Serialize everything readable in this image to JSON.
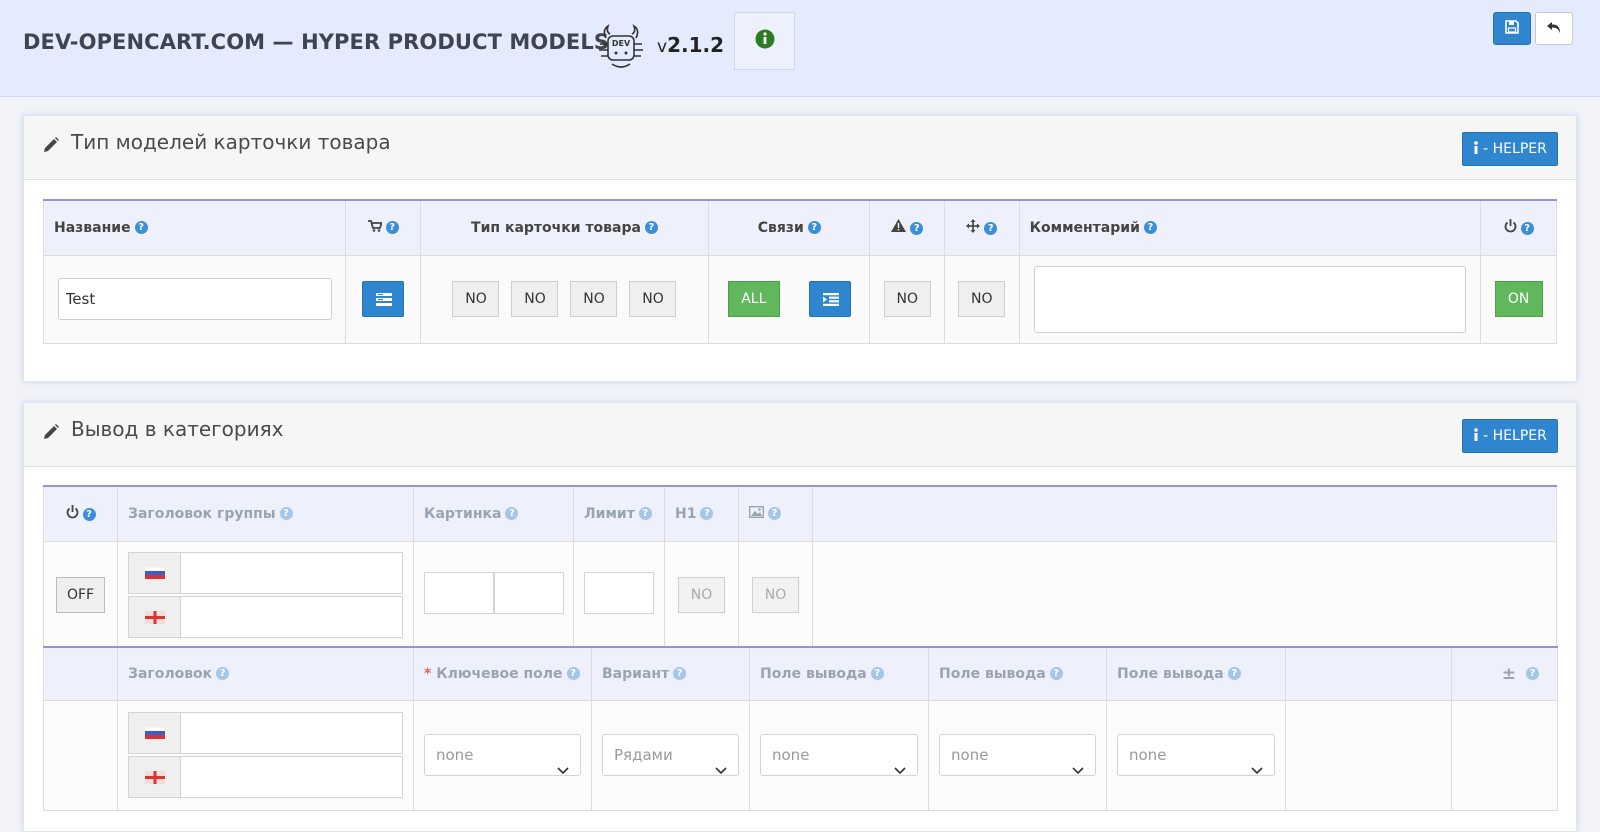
{
  "header": {
    "title": "DEV-OPENCART.COM — HYPER PRODUCT MODELS",
    "logo_text": "DEV",
    "version_prefix": "v",
    "version": "2.1.2"
  },
  "panel1": {
    "title": "Тип моделей карточки товара",
    "helper_label": "- HELPER",
    "columns": {
      "name": "Название",
      "card_type": "Тип карточки товара",
      "links": "Связи",
      "comment": "Комментарий"
    },
    "row": {
      "name_value": "Test",
      "card_type_buttons": [
        "NO",
        "NO",
        "NO",
        "NO"
      ],
      "links_all": "ALL",
      "warning_value": "NO",
      "move_value": "NO",
      "comment_value": "",
      "status": "ON"
    }
  },
  "panel2": {
    "title": "Вывод в категориях",
    "helper_label": "- HELPER",
    "group_columns": {
      "group_title": "Заголовок группы",
      "image": "Картинка",
      "limit": "Лимит",
      "h1": "H1"
    },
    "group_row": {
      "status": "OFF",
      "h1_value": "NO",
      "image_value": "NO"
    },
    "field_columns": {
      "title": "Заголовок",
      "key_field_required": "*",
      "key_field": "Ключевое поле",
      "variant": "Вариант",
      "output1": "Поле вывода",
      "output2": "Поле вывода",
      "output3": "Поле вывода",
      "plusminus": "±"
    },
    "field_row": {
      "key_field_value": "none",
      "variant_value": "Рядами",
      "output1_value": "none",
      "output2_value": "none",
      "output3_value": "none"
    }
  },
  "colors": {
    "accent_blue": "#2f86cf",
    "green": "#61b75c",
    "header_bg": "#e3ebfc",
    "table_top_border": "#9c8fd8"
  },
  "icons": [
    "logo-icon",
    "info-circle-icon",
    "save-icon",
    "undo-icon",
    "pencil-icon",
    "info-icon",
    "question-icon",
    "cart-icon",
    "list-icon",
    "indent-icon",
    "warning-icon",
    "move-icon",
    "power-icon",
    "image-icon",
    "flag-ru-icon",
    "flag-en-icon",
    "chevron-down-icon"
  ]
}
